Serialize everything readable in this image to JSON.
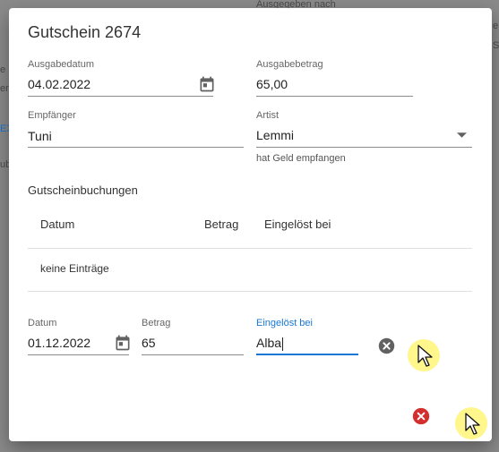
{
  "background": {
    "top_text": "Ausgegeben nach",
    "left_fragments": [
      "e",
      "en",
      "EX",
      "ub"
    ],
    "right_fragments": [
      "e",
      "S"
    ]
  },
  "dialog": {
    "title": "Gutschein 2674",
    "fields": {
      "ausgabedatum": {
        "label": "Ausgabedatum",
        "value": "04.02.2022"
      },
      "ausgabebetrag": {
        "label": "Ausgabebetrag",
        "value": "65,00"
      },
      "empfaenger": {
        "label": "Empfänger",
        "value": "Tuni"
      },
      "artist": {
        "label": "Artist",
        "value": "Lemmi",
        "hint": "hat Geld empfangen"
      }
    },
    "bookings": {
      "title": "Gutscheinbuchungen",
      "columns": [
        "Datum",
        "Betrag",
        "Eingelöst bei"
      ],
      "empty_text": "keine Einträge"
    },
    "new_entry": {
      "datum": {
        "label": "Datum",
        "value": "01.12.2022"
      },
      "betrag": {
        "label": "Betrag",
        "value": "65"
      },
      "eingeloest": {
        "label": "Eingelöst bei",
        "value": "Alba"
      }
    }
  },
  "colors": {
    "accent": "#1976d2",
    "danger": "#d32f2f",
    "neutral_icon": "#616161"
  }
}
